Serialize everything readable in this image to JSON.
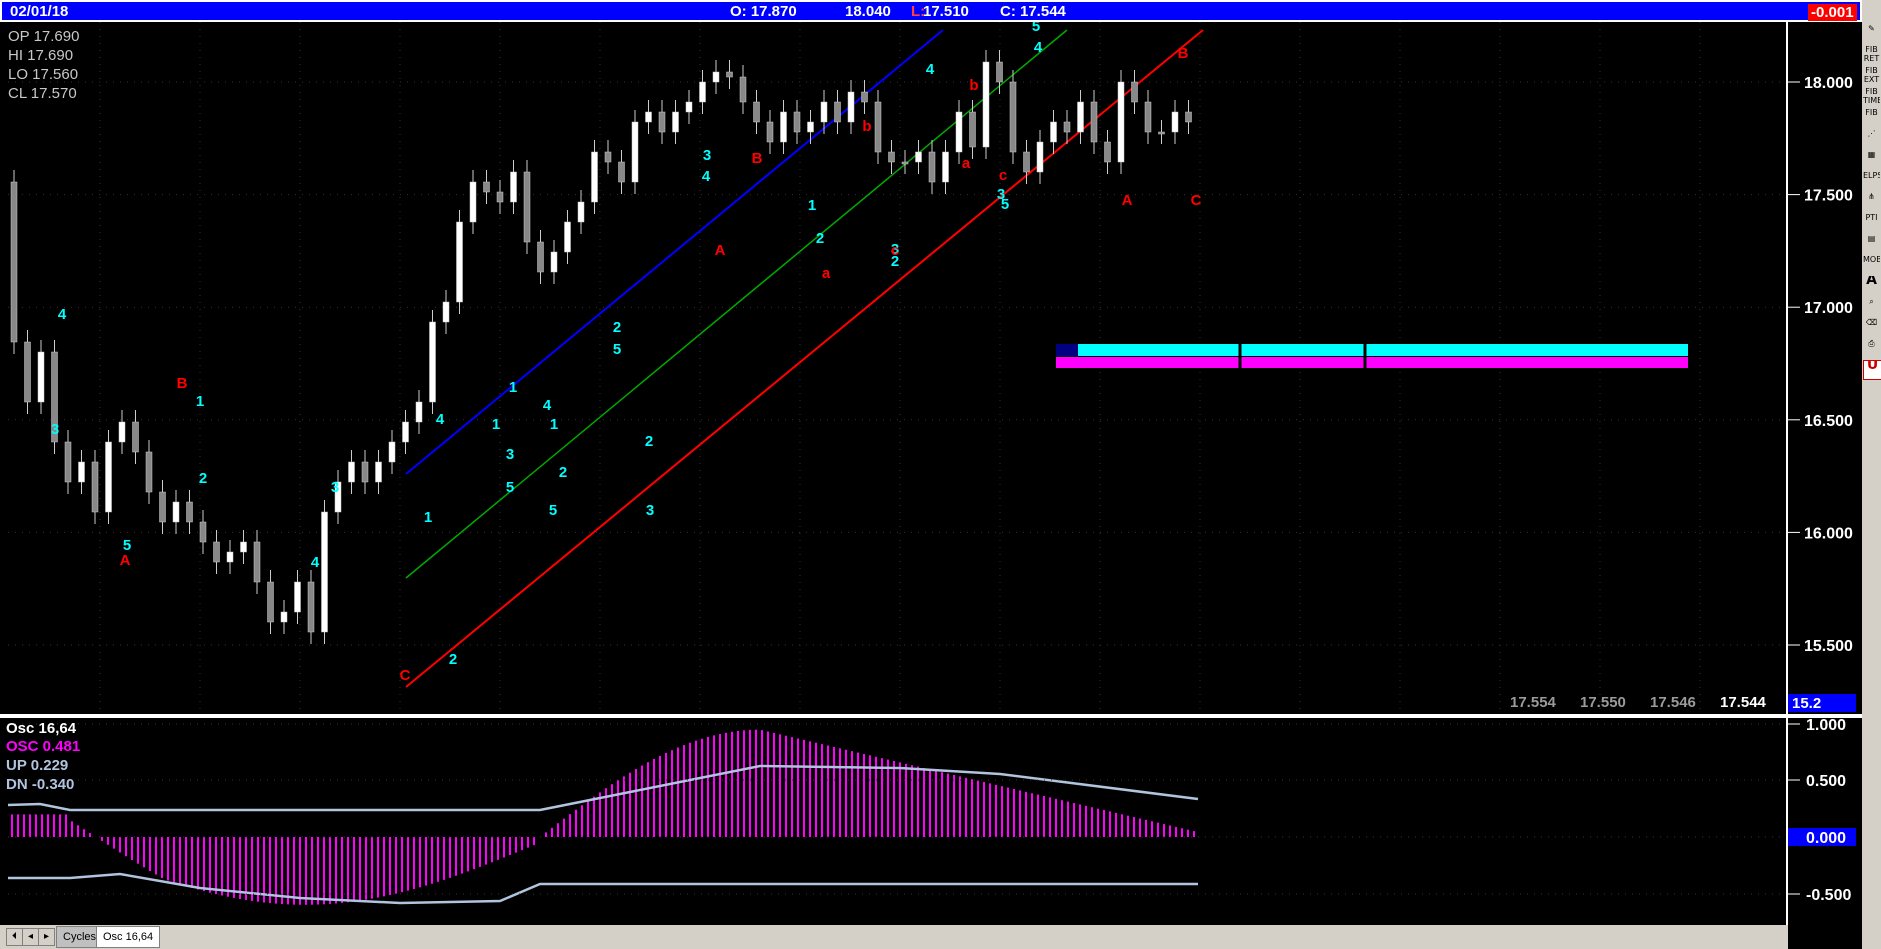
{
  "header": {
    "date": "02/01/18",
    "open": "O: 17.870",
    "high": "18.040",
    "low_prefix": "L:",
    "low_value": " 17.510",
    "close": "C: 17.544",
    "change": "-0.001"
  },
  "ohlc_box": {
    "open": "OP  17.690",
    "high": "HI   17.690",
    "low": "LO   17.560",
    "close": "CL   17.570"
  },
  "price_axis": {
    "labels": [
      "18.000",
      "17.500",
      "17.000",
      "16.500",
      "16.000",
      "15.500"
    ],
    "current": "15.2"
  },
  "price_readouts": [
    "17.554",
    "17.550",
    "17.546",
    "17.544"
  ],
  "oscillator": {
    "title": "Osc 16,64",
    "osc": "OSC 0.481",
    "up": "UP   0.229",
    "dn": "DN   -0.340",
    "axis_labels": [
      "1.000",
      "0.500",
      "0.000",
      "-0.500"
    ]
  },
  "tabs": [
    {
      "label": "Cycles"
    },
    {
      "label": "Osc 16,64"
    }
  ],
  "toolbar": [
    "pencil",
    "FIB RET",
    "FIB EXT",
    "FIB TIME",
    "FIB",
    "fan",
    "grid",
    "ELPS",
    "pitchfork",
    "PTI",
    "table",
    "MOB",
    "A",
    "zoom",
    "eraser",
    "print",
    "U"
  ],
  "colors": {
    "bg": "#000000",
    "header": "#0000ff",
    "cyan": "#00ffff",
    "red": "#ff0000",
    "magenta": "#ff00ff",
    "osc_line": "#b0c4de"
  },
  "wave_labels_cyan": [
    "4",
    "3",
    "5",
    "1",
    "2",
    "4",
    "3",
    "1",
    "2",
    "5",
    "1",
    "3",
    "5",
    "4",
    "1",
    "2",
    "2",
    "3",
    "4",
    "5",
    "3",
    "1",
    "2",
    "2",
    "4",
    "3",
    "5",
    "4",
    "1",
    "4",
    "2",
    "3",
    "5"
  ],
  "wave_labels_red": [
    "B",
    "A",
    "C",
    "B",
    "A",
    "a",
    "c",
    "b",
    "b",
    "a",
    "c",
    "B",
    "A",
    "C"
  ]
}
